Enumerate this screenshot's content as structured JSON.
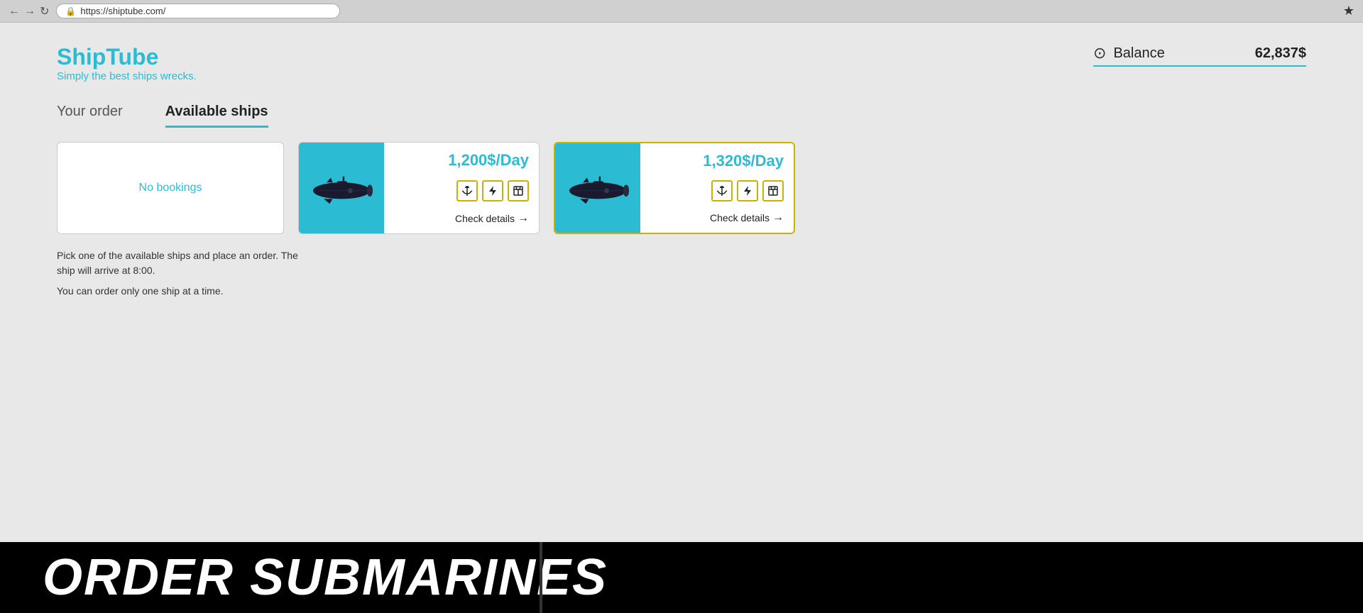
{
  "browser": {
    "url": "https://shiptube.com/"
  },
  "header": {
    "logo_title": "ShipTube",
    "logo_subtitle": "Simply the best ships wrecks.",
    "balance_label": "Balance",
    "balance_amount": "62,837$",
    "balance_icon": "💿"
  },
  "tabs": [
    {
      "id": "your-order",
      "label": "Your order",
      "active": false
    },
    {
      "id": "available-ships",
      "label": "Available ships",
      "active": true
    }
  ],
  "order_card": {
    "no_bookings_text": "No bookings"
  },
  "ships": [
    {
      "id": "ship1",
      "price": "1,200$/Day",
      "check_details": "Check details",
      "selected": false,
      "features": [
        "anchor",
        "lightning",
        "box"
      ]
    },
    {
      "id": "ship2",
      "price": "1,320$/Day",
      "check_details": "Check details",
      "selected": true,
      "features": [
        "anchor",
        "lightning",
        "box"
      ]
    }
  ],
  "info": {
    "line1": "Pick one of the available ships and place an order. The ship will arrive at 8:00.",
    "line2": "You can order only one ship at a time."
  },
  "banner": {
    "text": "ORDER SUBMARINES"
  }
}
